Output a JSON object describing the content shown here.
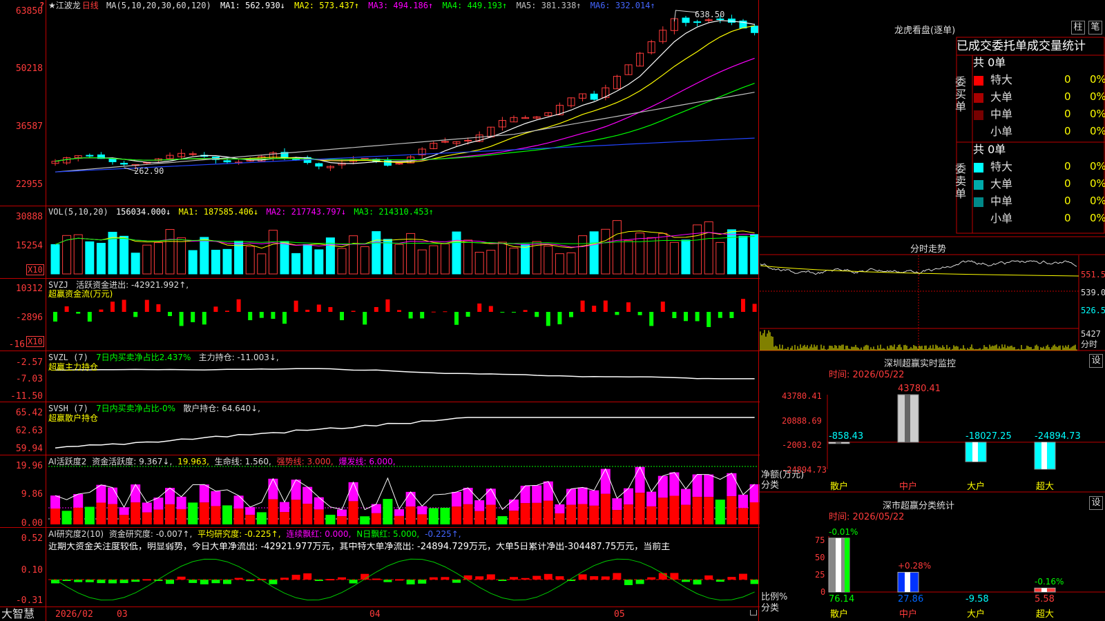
{
  "stock": {
    "title": "★江波龙",
    "period": "日线"
  },
  "main": {
    "ma_def": "MA(5,10,20,30,60,120)",
    "ma": [
      {
        "label": "MA1: 562.930↓",
        "color": "#ffffff"
      },
      {
        "label": "MA2: 573.437↑",
        "color": "#ffff00"
      },
      {
        "label": "MA3: 494.186↑",
        "color": "#ff00ff"
      },
      {
        "label": "MA4: 449.193↑",
        "color": "#00ff00"
      },
      {
        "label": "MA5: 381.338↑",
        "color": "#c0c0c0"
      },
      {
        "label": "MA6: 332.014↑",
        "color": "#2244ff"
      }
    ],
    "axis": [
      "63850",
      "50218",
      "36587",
      "22955"
    ],
    "ylim": [
      22955,
      63850
    ],
    "high_label": "638.50",
    "low_label": "262.90",
    "price_marker": "?"
  },
  "vol": {
    "def": "VOL(5,10,20)",
    "vals": [
      {
        "label": "156034.000↓",
        "color": "#ffffff"
      },
      {
        "label": "MA1: 187585.406↓",
        "color": "#ffff00"
      },
      {
        "label": "MA2: 217743.797↓",
        "color": "#ff00ff"
      },
      {
        "label": "MA3: 214310.453↑",
        "color": "#00ff00"
      }
    ],
    "axis": [
      "30888",
      "15254"
    ],
    "unit": "X10"
  },
  "svzj": {
    "name": "SVZJ",
    "text": "活跃资金进出: -42921.992↑,",
    "sub": "超赢资金流(万元)",
    "axis": [
      "10312",
      "-2896",
      "-16"
    ],
    "unit": "X10"
  },
  "svzl": {
    "name": "SVZL (7)",
    "pct": "7日内买卖净占比2.437%",
    "text": "主力持仓: -11.003↓,",
    "sub": "超赢主力持仓",
    "axis": [
      "-2.57",
      "-7.03",
      "-11.50"
    ]
  },
  "svsh": {
    "name": "SVSH (7)",
    "pct": "7日内买卖净占比-0%",
    "text": "散户持仓: 64.640↓,",
    "sub": "超赢散户持仓",
    "axis": [
      "65.42",
      "62.63",
      "59.94"
    ]
  },
  "ai1": {
    "name": "AI活跃度2",
    "t1": "资金活跃度: 9.367↓,",
    "t2": "19.963,",
    "t3": "生命线: 1.560,",
    "t4": "强势线: 3.000,",
    "t5": "爆发线: 6.000,",
    "axis": [
      "19.96",
      "9.86",
      "0.00"
    ]
  },
  "ai2": {
    "name": "AI研究度2(10)",
    "t1": "资金研究度: -0.007↑,",
    "t2": "平均研究度: -0.225↑,",
    "t3": "连续飘红: 0.000,",
    "t4": "N日飘红: 5.000,",
    "t5": "-0.225↑,",
    "desc": "近期大资金关注度较低，明显弱势，今日大单净流出: -42921.977万元，其中特大单净流出: -24894.729万元，大单5日累计净出-304487.75万元，当前主",
    "axis": [
      "0.52",
      "0.10",
      "-0.31"
    ]
  },
  "bottom": {
    "brand": "大智慧",
    "dates": [
      "2026/02",
      "03",
      "04",
      "05"
    ]
  },
  "longhu": {
    "title": "龙虎看盘(逐单)",
    "btn1": "柱",
    "btn2": "笔",
    "header": "已成交委托单成交量统计",
    "buy_label": "委买单",
    "sell_label": "委卖单",
    "buy_total": "共 0单",
    "sell_total": "共 0单",
    "buy": [
      {
        "name": "特大",
        "n": "0",
        "p": "0%",
        "color": "#ff0000"
      },
      {
        "name": "大单",
        "n": "0",
        "p": "0%",
        "color": "#aa0000"
      },
      {
        "name": "中单",
        "n": "0",
        "p": "0%",
        "color": "#770000"
      },
      {
        "name": "小单",
        "n": "0",
        "p": "0%",
        "color": ""
      }
    ],
    "sell": [
      {
        "name": "特大",
        "n": "0",
        "p": "0%",
        "color": "#00ffff"
      },
      {
        "name": "大单",
        "n": "0",
        "p": "0%",
        "color": "#00aaaa"
      },
      {
        "name": "中单",
        "n": "0",
        "p": "0%",
        "color": "#008888"
      },
      {
        "name": "小单",
        "n": "0",
        "p": "0%",
        "color": ""
      }
    ]
  },
  "fenshi": {
    "title": "分时走势",
    "axis": [
      "551.5",
      "539.0",
      "526.5"
    ],
    "vol": "5427",
    "unit": "分时"
  },
  "monitor": {
    "title": "深圳超赢实时监控",
    "btn": "设",
    "time": "时间: 2026/05/22",
    "axis": [
      "43780.41",
      "20888.69",
      "-2003.02",
      "-24894.73"
    ],
    "ylabel": "净额(万元)",
    "xlabel": "分类",
    "chart_data": {
      "type": "bar",
      "categories": [
        "散户",
        "中户",
        "大户",
        "超大"
      ],
      "values": [
        -858.43,
        43780.41,
        -18027.25,
        -24894.73
      ],
      "labels": [
        "-858.43",
        "43780.41",
        "-18027.25",
        "-24894.73"
      ],
      "ylim": [
        -24894.73,
        43780.41
      ]
    }
  },
  "classify": {
    "title": "深市超赢分类统计",
    "btn": "设",
    "time": "时间: 2026/05/22",
    "axis": [
      "75",
      "50",
      "25",
      "0"
    ],
    "ylabel": "比例%",
    "xlabel": "分类",
    "chart_data": {
      "type": "bar",
      "categories": [
        "散户",
        "中户",
        "大户",
        "超大"
      ],
      "values": [
        76.14,
        27.86,
        -9.58,
        5.58
      ],
      "changes": [
        "-0.01%",
        "+0.28%",
        "",
        "-0.16%"
      ],
      "labels": [
        "76.14",
        "27.86",
        "-9.58",
        "5.58"
      ],
      "ylim": [
        0,
        75
      ]
    }
  }
}
